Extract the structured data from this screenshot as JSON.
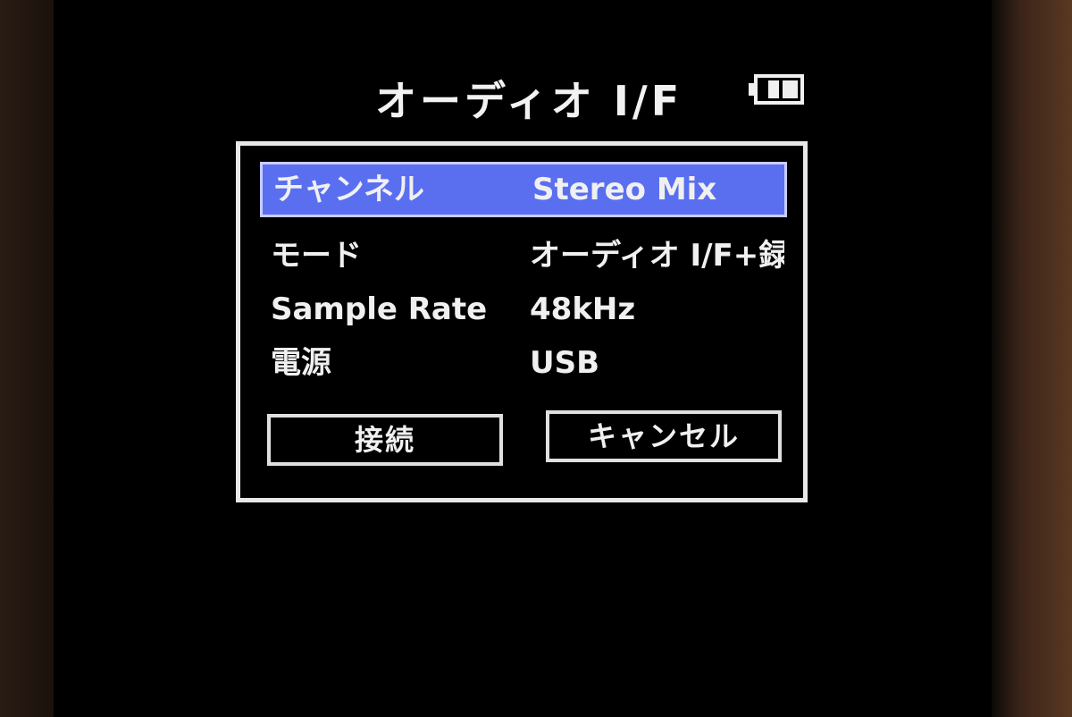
{
  "screen": {
    "title": "オーディオ I/F",
    "battery_icon": "battery-icon"
  },
  "dialog": {
    "rows": [
      {
        "label": "チャンネル",
        "value": "Stereo Mix",
        "selected": true
      },
      {
        "label": "モード",
        "value": "オーディオ I/F+録音",
        "selected": false
      },
      {
        "label": "Sample Rate",
        "value": "48kHz",
        "selected": false
      },
      {
        "label": "電源",
        "value": "USB",
        "selected": false
      }
    ],
    "buttons": {
      "connect": "接続",
      "cancel": "キャンセル"
    }
  },
  "colors": {
    "highlight": "#5a6ff0",
    "text": "#f0f0f0",
    "background": "#000000"
  }
}
